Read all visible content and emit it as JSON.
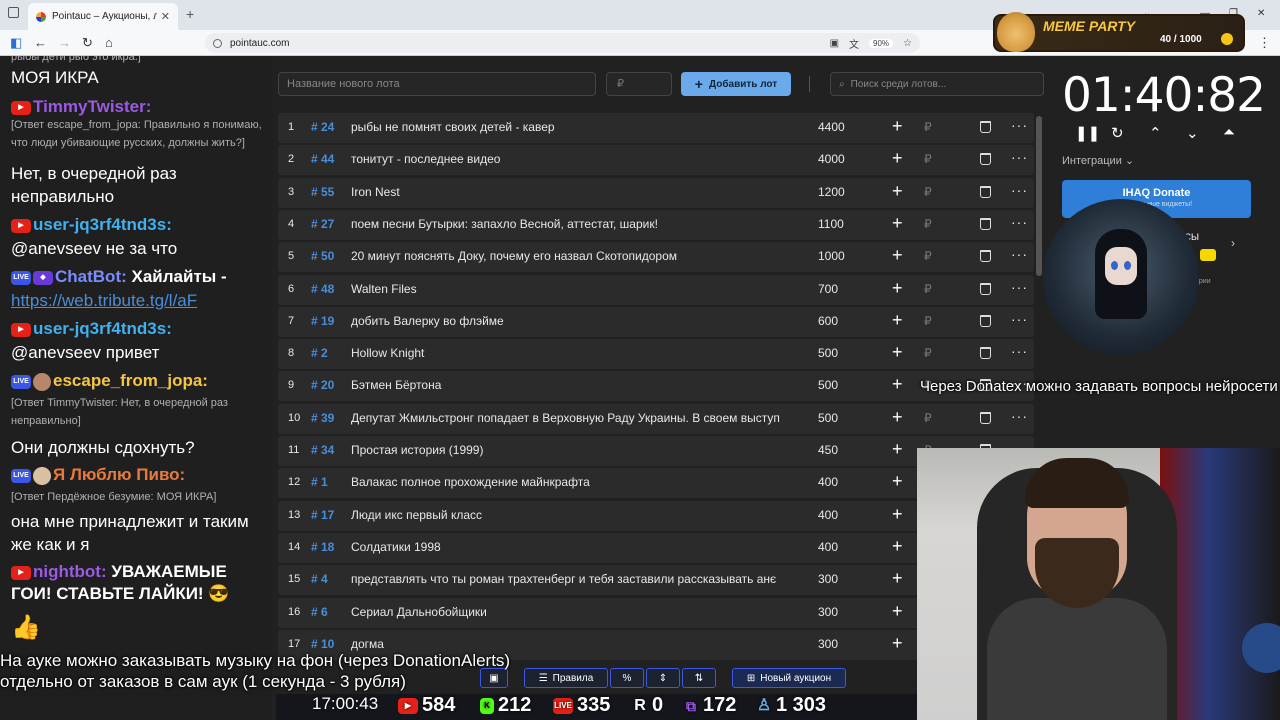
{
  "browser": {
    "tab_title": "Pointauc – Аукционы, лотереи",
    "url": "pointauc.com",
    "zoom": "90%"
  },
  "chat": {
    "lines": [
      {
        "type": "reply",
        "text": "рыбы дети рыб это икра.]"
      },
      {
        "type": "msg",
        "text": "МОЯ ИКРА"
      },
      {
        "type": "user",
        "name": "TimmyTwister:",
        "color": "#9b59e6"
      },
      {
        "type": "reply",
        "text": "[Ответ escape_from_jopa: Правильно я понимаю, что люди убивающие русских, должны жить?]"
      },
      {
        "type": "msg",
        "text": "Нет, в очередной раз неправильно"
      },
      {
        "type": "user",
        "name": "user-jq3rf4tnd3s:",
        "color": "#3fb1f0"
      },
      {
        "type": "msg",
        "text": "@anevseev не за что"
      },
      {
        "type": "user",
        "name": "ChatBot:",
        "color": "#7a8cff",
        "text": "Хайлайты -"
      },
      {
        "type": "link",
        "text": "https://web.tribute.tg/l/aF"
      },
      {
        "type": "user",
        "name": "user-jq3rf4tnd3s:",
        "color": "#3fb1f0"
      },
      {
        "type": "msg",
        "text": "@anevseev привет"
      },
      {
        "type": "user",
        "name": "escape_from_jopa:",
        "color": "#f4c542"
      },
      {
        "type": "reply",
        "text": "[Ответ TimmyTwister: Нет, в очередной раз неправильно]"
      },
      {
        "type": "msg",
        "text": "Они должны сдохнуть?"
      },
      {
        "type": "user",
        "name": "Я Люблю Пиво:",
        "color": "#e87a3b"
      },
      {
        "type": "reply",
        "text": "[Ответ Пердёжное безумие: МОЯ ИКРА]"
      },
      {
        "type": "msg",
        "text": "она мне принадлежит и таким же как и я"
      },
      {
        "type": "user",
        "name": "nightbot:",
        "color": "#9b59e6",
        "text": "УВАЖАЕМЫЕ ГОИ! СТАВЬТЕ ЛАЙКИ! 😎"
      },
      {
        "type": "msg",
        "text": "👍"
      }
    ]
  },
  "toolbar": {
    "new_lot_placeholder": "Название нового лота",
    "price_placeholder": "₽",
    "add_button": "Добавить лот",
    "search_placeholder": "Поиск среди лотов..."
  },
  "lots": [
    {
      "n": "1",
      "id": "# 24",
      "name": "рыбы не помнят своих детей - кавер",
      "amount": "4400"
    },
    {
      "n": "2",
      "id": "# 44",
      "name": "тонитут - последнее видео",
      "amount": "4000"
    },
    {
      "n": "3",
      "id": "# 55",
      "name": "Iron Nest",
      "amount": "1200"
    },
    {
      "n": "4",
      "id": "# 27",
      "name": "поем песни Бутырки: запахло Весной, аттестат, шарик!",
      "amount": "1100"
    },
    {
      "n": "5",
      "id": "# 50",
      "name": "20 минут пояснять Доку, почему его назвал Скотопидором",
      "amount": "1000"
    },
    {
      "n": "6",
      "id": "# 48",
      "name": "Walten Files",
      "amount": "700"
    },
    {
      "n": "7",
      "id": "# 19",
      "name": "добить Валерку во флэйме",
      "amount": "600"
    },
    {
      "n": "8",
      "id": "# 2",
      "name": "Hollow Knight",
      "amount": "500"
    },
    {
      "n": "9",
      "id": "# 20",
      "name": "Бэтмен Бёртона",
      "amount": "500"
    },
    {
      "n": "10",
      "id": "# 39",
      "name": "Депутат Жмильстронг попадает в Верховную Раду Украины. В своем выступ",
      "amount": "500"
    },
    {
      "n": "11",
      "id": "# 34",
      "name": "Простая история (1999)",
      "amount": "450"
    },
    {
      "n": "12",
      "id": "# 1",
      "name": "Валакас полное прохождение майнкрафта",
      "amount": "400"
    },
    {
      "n": "13",
      "id": "# 17",
      "name": "Люди икс первый класс",
      "amount": "400"
    },
    {
      "n": "14",
      "id": "# 18",
      "name": "Солдатики 1998",
      "amount": "400"
    },
    {
      "n": "15",
      "id": "# 4",
      "name": "представлять что ты роман трахтенберг и тебя заставили рассказывать анє",
      "amount": "300"
    },
    {
      "n": "16",
      "id": "# 6",
      "name": "Сериал Дальнобойщики",
      "amount": "300"
    },
    {
      "n": "17",
      "id": "# 10",
      "name": "догма",
      "amount": "300"
    }
  ],
  "currency": "₽",
  "bottom": {
    "rules": "Правила",
    "percent": "%",
    "new_auction": "Новый аукцион"
  },
  "timer": {
    "value": "01:40:82",
    "integrations": "Интеграции",
    "donate_title": "IHAQ Donate",
    "donate_sub": "уникальные виджеты!",
    "side_text_1": "ИСЫ",
    "side_text_2": "ории"
  },
  "meme": {
    "title": "MEME PARTY",
    "count": "40 / 1000"
  },
  "captions": {
    "right": "Через Donatex можно задавать вопросы нейросети",
    "bottom_1": "На ауке можно заказывать музыку на фон (через DonationAlerts)",
    "bottom_2": "отдельно от заказов в сам аук (1 секунда - 3 рубля)"
  },
  "stats": {
    "time": "17:00:43",
    "youtube": "584",
    "kick": "212",
    "vk": "335",
    "rutube": "0",
    "twitch": "172",
    "viewers": "1 303"
  },
  "colors": {
    "accent": "#6aa9ea",
    "id_blue": "#4a8ed8",
    "row_bg": "#2b2b2b"
  }
}
